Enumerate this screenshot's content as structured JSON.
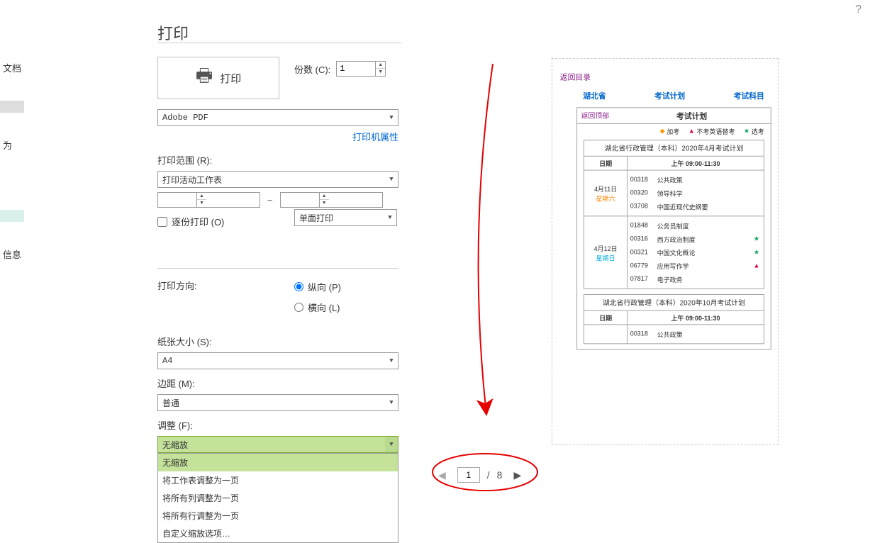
{
  "help_icon": "?",
  "sidebar": {
    "items": [
      "文档",
      "",
      "为",
      "",
      "",
      "信息"
    ]
  },
  "title": "打印",
  "print_button": {
    "label": "打印"
  },
  "copies": {
    "label": "份数 (C):",
    "value": "1"
  },
  "printer_select": "Adobe PDF",
  "printer_props_link": "打印机属性",
  "range": {
    "label": "打印范围 (R):",
    "selected": "打印活动工作表",
    "from": "",
    "to": ""
  },
  "collate": {
    "label": "逐份打印 (O)"
  },
  "duplex": {
    "selected": "单面打印"
  },
  "orientation": {
    "label": "打印方向:",
    "portrait": "纵向 (P)",
    "landscape": "横向 (L)"
  },
  "paper_size": {
    "label": "纸张大小 (S):",
    "selected": "A4"
  },
  "margins": {
    "label": "边距 (M):",
    "selected": "普通"
  },
  "scaling": {
    "label": "调整 (F):",
    "selected": "无缩放",
    "options": [
      "无缩放",
      "将工作表调整为一页",
      "将所有列调整为一页",
      "将所有行调整为一页",
      "自定义缩放选项…"
    ]
  },
  "page_nav": {
    "current": "1",
    "total": "8"
  },
  "preview": {
    "return_toc": "返回目录",
    "head_links": [
      "湖北省",
      "考试计划",
      "考试科目"
    ],
    "return_top": "返回顶部",
    "plan_title": "考试计划",
    "legend": [
      {
        "icon": "◆",
        "cls": "diamond-orange",
        "text": "加考"
      },
      {
        "icon": "▲",
        "cls": "tri-red",
        "text": "不考英语替考"
      },
      {
        "icon": "★",
        "cls": "star-green",
        "text": "选考"
      }
    ],
    "tables": [
      {
        "title": "湖北省行政管理（本科）2020年4月考试计划",
        "thead": {
          "date": "日期",
          "slot": "上午 09:00-11:30"
        },
        "rows": [
          {
            "date": "4月11日",
            "dow": "星期六",
            "dow_cls": "dow-sat",
            "courses": [
              {
                "code": "00318",
                "name": "公共政策",
                "marker": ""
              },
              {
                "code": "00320",
                "name": "领导科学",
                "marker": ""
              },
              {
                "code": "03708",
                "name": "中国近现代史纲要",
                "marker": ""
              }
            ]
          },
          {
            "date": "4月12日",
            "dow": "星期日",
            "dow_cls": "dow-sun",
            "courses": [
              {
                "code": "01848",
                "name": "公务员制度",
                "marker": ""
              },
              {
                "code": "00316",
                "name": "西方政治制度",
                "marker": "★",
                "mcls": "star-green"
              },
              {
                "code": "00321",
                "name": "中国文化概论",
                "marker": "★",
                "mcls": "star-green"
              },
              {
                "code": "06779",
                "name": "应用写作学",
                "marker": "▲",
                "mcls": "tri-red"
              },
              {
                "code": "07817",
                "name": "电子政务",
                "marker": ""
              }
            ]
          }
        ]
      },
      {
        "title": "湖北省行政管理（本科）2020年10月考试计划",
        "thead": {
          "date": "日期",
          "slot": "上午 09:00-11:30"
        },
        "rows": [
          {
            "date": "",
            "dow": "",
            "dow_cls": "",
            "courses": [
              {
                "code": "00318",
                "name": "公共政策",
                "marker": ""
              }
            ]
          }
        ]
      }
    ]
  }
}
